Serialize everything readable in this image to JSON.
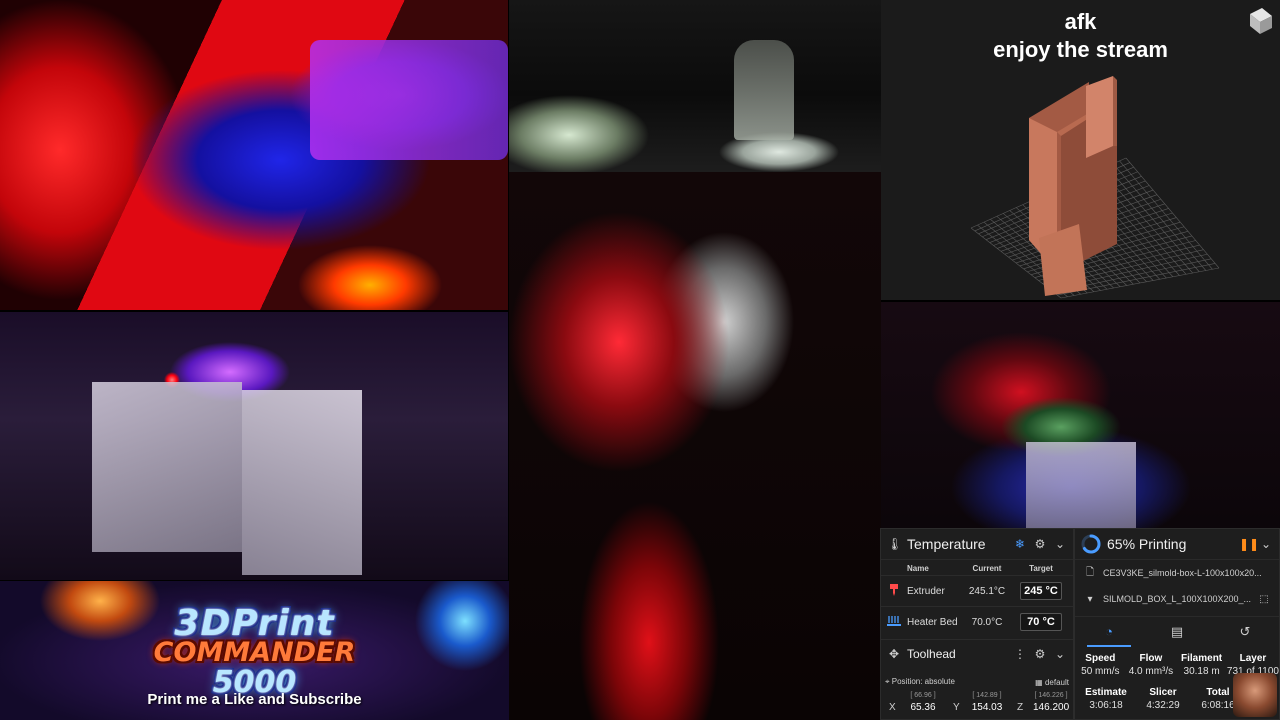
{
  "overlay": {
    "line1": "afk",
    "line2": "enjoy the stream"
  },
  "promo": {
    "line1": "3DPrint",
    "line2": "COMMANDER",
    "line3": "5000",
    "tagline": "Print me a Like and Subscribe"
  },
  "temperature": {
    "title": "Temperature",
    "columns": [
      "Name",
      "Current",
      "Target"
    ],
    "rows": [
      {
        "name": "Extruder",
        "current": "245.1°C",
        "target": "245 °C",
        "icon": "extruder-icon"
      },
      {
        "name": "Heater Bed",
        "current": "70.0°C",
        "target": "70 °C",
        "icon": "heater-bed-icon"
      }
    ]
  },
  "toolhead": {
    "title": "Toolhead",
    "position_label": "Position: absolute",
    "default_label": "default",
    "axes": [
      {
        "label": "X",
        "max": "[ 66.96 ]",
        "value": "65.36"
      },
      {
        "label": "Y",
        "max": "[ 142.89 ]",
        "value": "154.03"
      },
      {
        "label": "Z",
        "max": "[ 146.226 ]",
        "value": "146.200"
      }
    ]
  },
  "print_status": {
    "title": "65% Printing",
    "progress": 0.65,
    "file_gcode": "CE3V3KE_silmold-box-L-100x100x20...",
    "file_object": "SILMOLD_BOX_L_100X100X200_...",
    "tabs": [
      "speed-tab",
      "files-tab",
      "history-tab"
    ],
    "stats_row1": [
      {
        "label": "Speed",
        "value": "50 mm/s"
      },
      {
        "label": "Flow",
        "value": "4.0 mm³/s"
      },
      {
        "label": "Filament",
        "value": "30.18 m"
      },
      {
        "label": "Layer",
        "value": "731 of 1100"
      }
    ],
    "stats_row2": [
      {
        "label": "Estimate",
        "value": "3:06:18"
      },
      {
        "label": "Slicer",
        "value": "4:32:29"
      },
      {
        "label": "Total",
        "value": "6:08:16"
      }
    ]
  },
  "colors": {
    "accent": "#4a9cff",
    "pause": "#ff8c1a",
    "model": "#e08a6a"
  }
}
